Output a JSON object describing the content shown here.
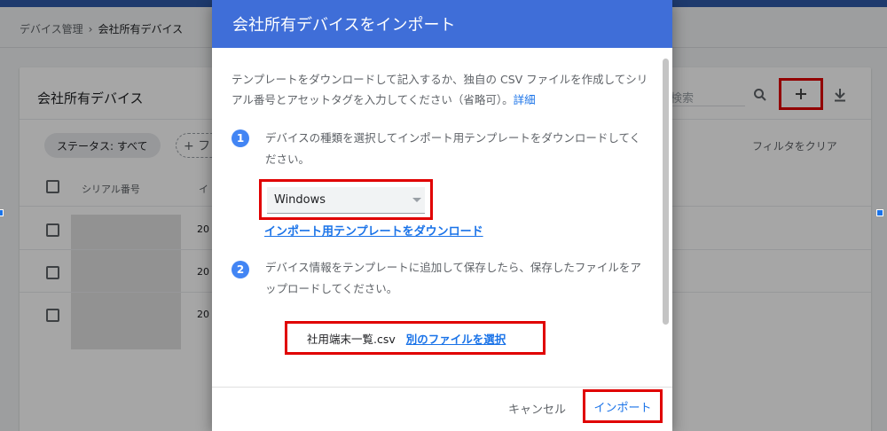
{
  "breadcrumb": {
    "parent": "デバイス管理",
    "separator": "›",
    "current": "会社所有デバイス"
  },
  "card": {
    "title": "会社所有デバイス",
    "search_placeholder": "検索",
    "filter_chip": "ステータス: すべて",
    "add_filter": "+ フ",
    "clear_filter": "フィルタをクリア",
    "columns": [
      "シリアル番号",
      "イ"
    ],
    "rows": [
      {
        "col2": "20"
      },
      {
        "col2": "20"
      },
      {
        "col2": "20"
      }
    ]
  },
  "dialog": {
    "title": "会社所有デバイスをインポート",
    "intro_text": "テンプレートをダウンロードして記入するか、独自の CSV ファイルを作成してシリアル番号とアセットタグを入力してください（省略可）。",
    "intro_link": "詳細",
    "step1_number": "1",
    "step1_text": "デバイスの種類を選択してインポート用テンプレートをダウンロードしてください。",
    "device_type_selected": "Windows",
    "download_template_link": "インポート用テンプレートをダウンロード",
    "step2_number": "2",
    "step2_text": "デバイス情報をテンプレートに追加して保存したら、保存したファイルをアップロードしてください。",
    "file_name": "社用端末一覧.csv",
    "choose_other_file": "別のファイルを選択",
    "cancel_label": "キャンセル",
    "import_label": "インポート"
  },
  "icons": {
    "search": "search-icon",
    "add": "plus-icon",
    "download": "download-icon",
    "dropdown": "chevron-down-icon"
  },
  "colors": {
    "dialog_header": "#3f6ed8",
    "link": "#1a73e8",
    "step_badge": "#4285f4",
    "highlight_box": "#e00000"
  }
}
